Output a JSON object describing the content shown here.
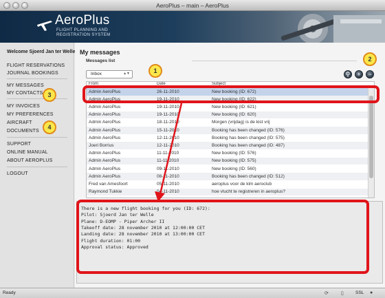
{
  "window": {
    "title": "AeroPlus – main – AeroPlus"
  },
  "brand": {
    "name": "AeroPlus",
    "subtitle1": "FLIGHT PLANNING AND",
    "subtitle2": "REGISTRATION SYSTEM"
  },
  "sidebar": {
    "welcome": "Welcome Sjoerd Jan ter Welle",
    "items": [
      "FLIGHT RESERVATIONS",
      "JOURNAL BOOKINGS",
      "MY MESSAGES",
      "MY CONTACTS",
      "MY INVOICES",
      "MY PREFERENCES",
      "AIRCRAFT",
      "DOCUMENTS",
      "SUPPORT",
      "ONLINE MANUAL",
      "ABOUT AEROPLUS",
      "LOGOUT"
    ]
  },
  "main": {
    "title": "My messages",
    "section": "Messages list",
    "folder": "Inbox",
    "columns": {
      "from": "From",
      "date": "Date",
      "subject": "Subject"
    },
    "rows": [
      {
        "from": "Admin AeroPlus",
        "date": "26-11-2010",
        "subject": "New booking (ID: 672)"
      },
      {
        "from": "Admin AeroPlus",
        "date": "19-11-2010",
        "subject": "New booking (ID: 622)"
      },
      {
        "from": "Admin AeroPlus",
        "date": "19-11-2010",
        "subject": "New booking (ID: 621)"
      },
      {
        "from": "Admin AeroPlus",
        "date": "19-11-2010",
        "subject": "New booking (ID: 620)"
      },
      {
        "from": "Admin AeroPlus",
        "date": "18-11-2010",
        "subject": "Morgen (vrijdag) is de kist vrij"
      },
      {
        "from": "Admin AeroPlus",
        "date": "15-11-2010",
        "subject": "Booking has been changed (ID: 576)"
      },
      {
        "from": "Admin AeroPlus",
        "date": "12-11-2010",
        "subject": "Booking has been changed (ID: 575)"
      },
      {
        "from": "Joeri Borrius",
        "date": "12-11-2010",
        "subject": "Booking has been changed (ID: 487)"
      },
      {
        "from": "Admin AeroPlus",
        "date": "11-11-2010",
        "subject": "New booking (ID: 576)"
      },
      {
        "from": "Admin AeroPlus",
        "date": "11-11-2010",
        "subject": "New booking (ID: 575)"
      },
      {
        "from": "Admin AeroPlus",
        "date": "09-11-2010",
        "subject": "New booking (ID: 560)"
      },
      {
        "from": "Admin AeroPlus",
        "date": "08-11-2010",
        "subject": "Booking has been changed (ID: 512)"
      },
      {
        "from": "Fred van Amesfoort",
        "date": "05-11-2010",
        "subject": "aeroplus voor de klm aeroclub"
      },
      {
        "from": "Raymond Tukkie",
        "date": "04-11-2010",
        "subject": "hoe vlucht te registreren in aeroplus?"
      }
    ],
    "detail": [
      "There is a new flight booking for you (ID: 672):",
      "Pilot: Sjoerd Jan ter Welle",
      "Plane: D-EOMP - Piper Archer II",
      "Takeoff date: 28 november 2010 at 12:00:00 CET",
      "Landing date: 28 november 2010 at 13:00:00 CET",
      "Flight duration: 01:00",
      "Approval status: Approved"
    ]
  },
  "annotations": {
    "b1": "1",
    "b2": "2",
    "b3": "3",
    "b4": "4"
  },
  "status": {
    "text": "Ready",
    "ssl": "SSL"
  }
}
